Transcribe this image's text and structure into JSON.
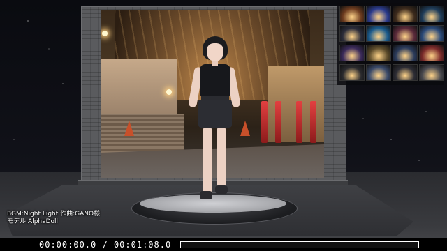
{
  "credits": {
    "bgm": "BGM:Night Light 作曲:GANO様",
    "model": "モデル:AlphaDoll"
  },
  "player": {
    "current_time": "00:00:00.0",
    "separator": "/",
    "total_time": "00:01:08.0",
    "progress": 0.0
  },
  "gallery": {
    "thumbnails": [
      {
        "name": "thumb-1",
        "color": "#6b3a1e"
      },
      {
        "name": "thumb-2",
        "color": "#2a3a8c"
      },
      {
        "name": "thumb-3",
        "color": "#3c2a1c"
      },
      {
        "name": "thumb-4",
        "color": "#1e3c5a"
      },
      {
        "name": "thumb-5",
        "color": "#2b2c3a"
      },
      {
        "name": "thumb-6",
        "color": "#1a5a8c"
      },
      {
        "name": "thumb-7",
        "color": "#5a2a3a"
      },
      {
        "name": "thumb-8",
        "color": "#2a4a7a"
      },
      {
        "name": "thumb-9",
        "color": "#3a2a5a"
      },
      {
        "name": "thumb-10",
        "color": "#5a4a2a"
      },
      {
        "name": "thumb-11",
        "color": "#2a3a5a"
      },
      {
        "name": "thumb-12",
        "color": "#7a2a2a"
      },
      {
        "name": "thumb-13",
        "color": "#2a2a2e"
      },
      {
        "name": "thumb-14",
        "color": "#3a4a6a"
      },
      {
        "name": "thumb-15",
        "color": "#2c2c34"
      },
      {
        "name": "thumb-16",
        "color": "#4a4a50"
      }
    ]
  }
}
